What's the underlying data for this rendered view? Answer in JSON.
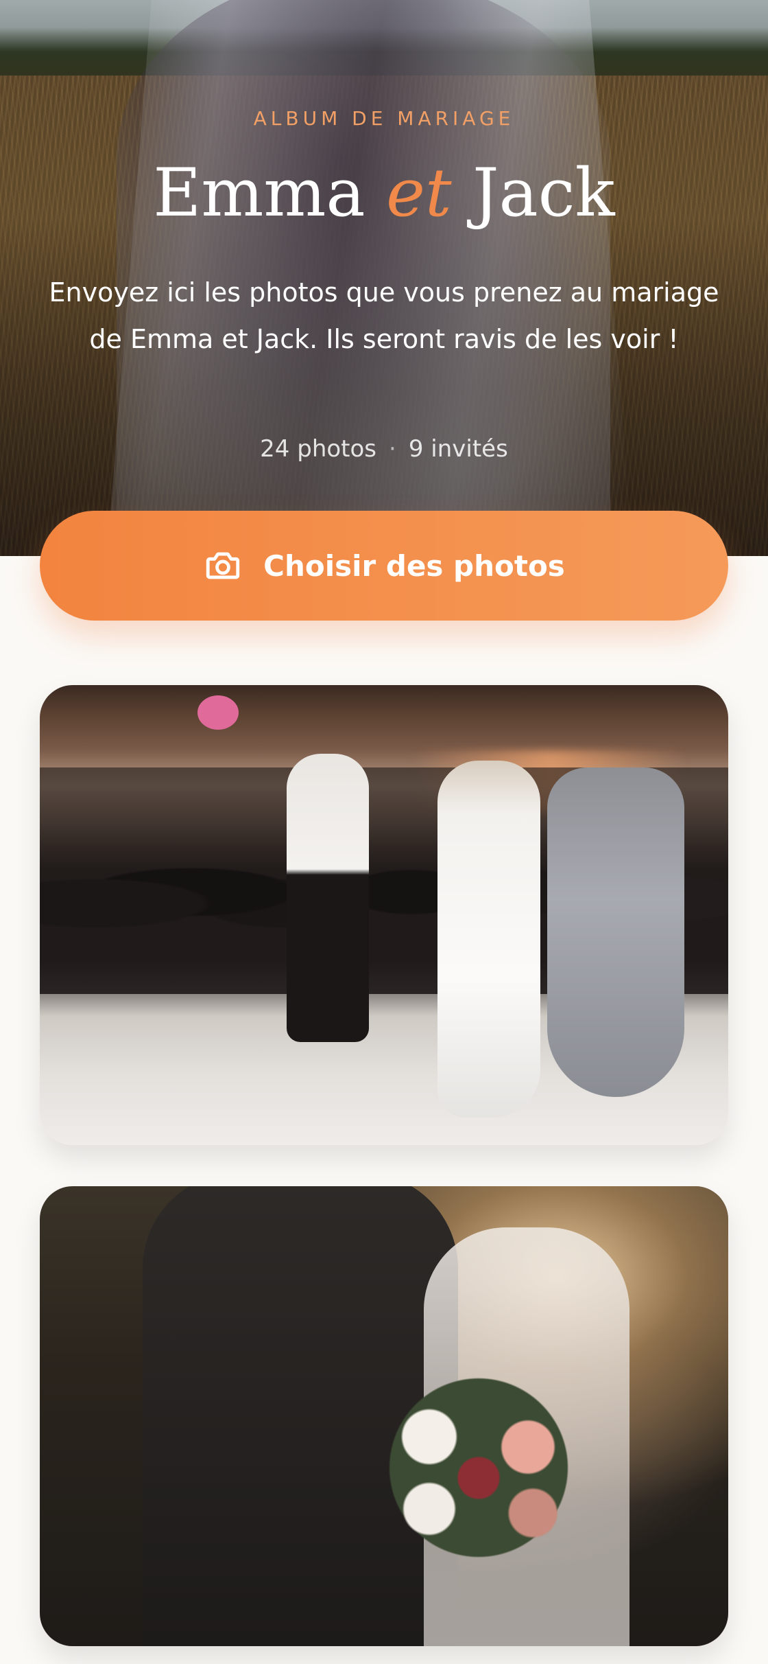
{
  "hero": {
    "eyebrow": "ALBUM DE MARIAGE",
    "title_part1": "Emma ",
    "title_amp": "et",
    "title_part2": " Jack",
    "subtitle": "Envoyez ici les photos que vous prenez au mariage de Emma et Jack. Ils seront ravis de les voir !",
    "stats": {
      "photos": "24 photos",
      "separator": "·",
      "guests": "9 invités"
    },
    "background_image": "couple-veil-wheat-field"
  },
  "cta": {
    "label": "Choisir des photos",
    "icon": "camera-icon",
    "color_start": "#f2843f",
    "color_end": "#f59a59"
  },
  "photos": [
    {
      "subject": "wedding-dance-floor"
    },
    {
      "subject": "bride-bouquet-sunlight"
    }
  ],
  "colors": {
    "accent": "#f0894a",
    "eyebrow": "#f3a066",
    "background": "#fbf9f6"
  }
}
